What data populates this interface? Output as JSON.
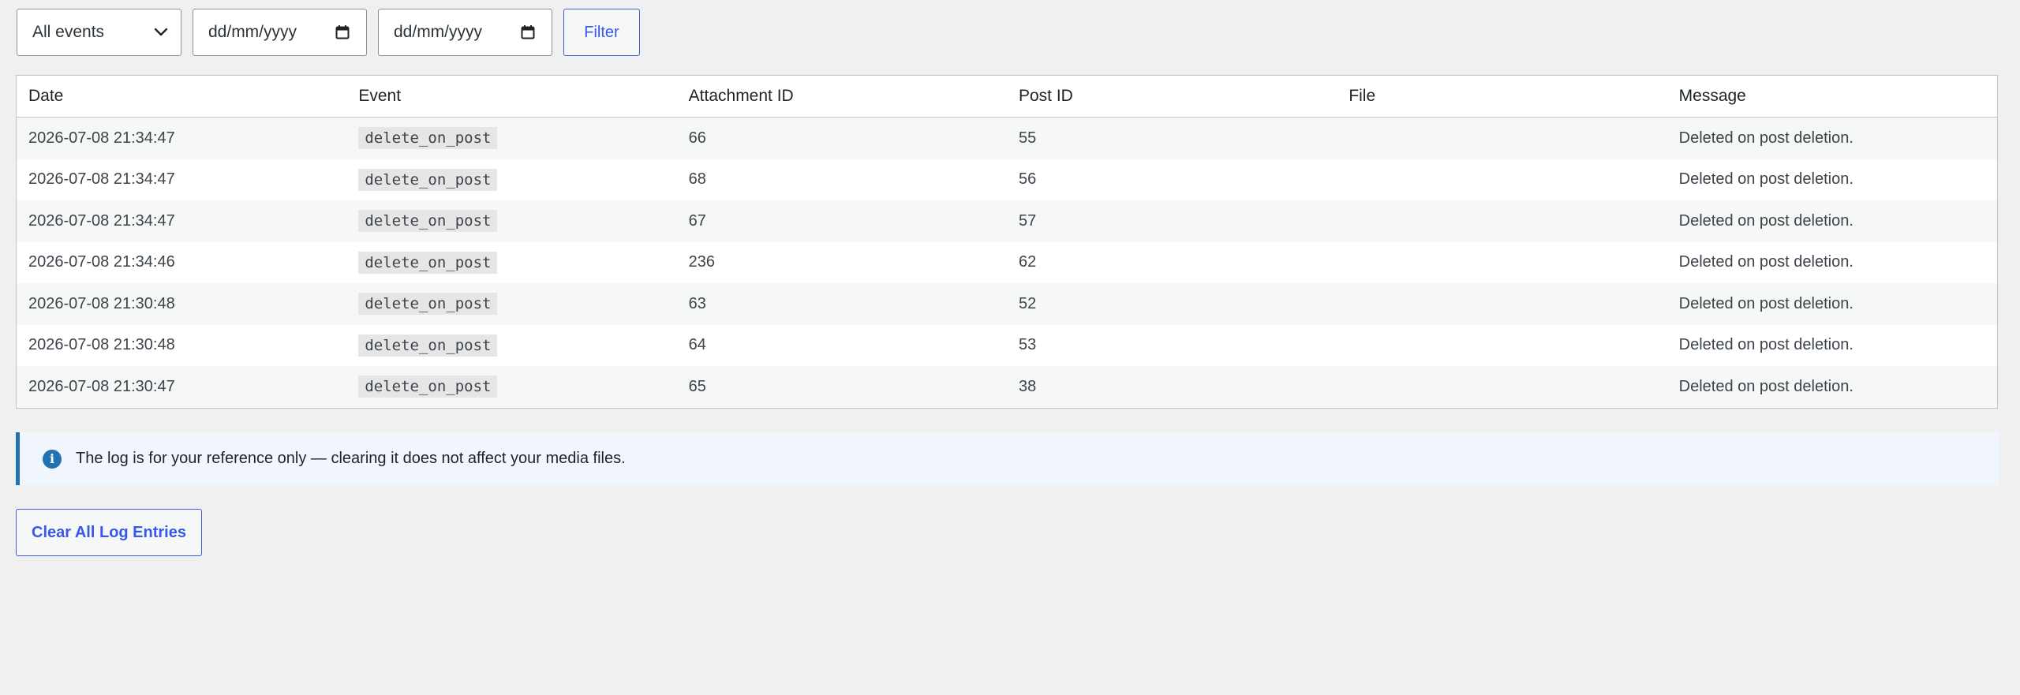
{
  "filters": {
    "event_select": {
      "value": "All events"
    },
    "date_from": {
      "placeholder": "dd/mm/yyyy"
    },
    "date_to": {
      "placeholder": "dd/mm/yyyy"
    },
    "filter_label": "Filter"
  },
  "table": {
    "headers": [
      "Date",
      "Event",
      "Attachment ID",
      "Post ID",
      "File",
      "Message"
    ],
    "rows": [
      {
        "date": "2026-07-08 21:34:47",
        "event": "delete_on_post",
        "attachment_id": "66",
        "post_id": "55",
        "file": "",
        "message": "Deleted on post deletion."
      },
      {
        "date": "2026-07-08 21:34:47",
        "event": "delete_on_post",
        "attachment_id": "68",
        "post_id": "56",
        "file": "",
        "message": "Deleted on post deletion."
      },
      {
        "date": "2026-07-08 21:34:47",
        "event": "delete_on_post",
        "attachment_id": "67",
        "post_id": "57",
        "file": "",
        "message": "Deleted on post deletion."
      },
      {
        "date": "2026-07-08 21:34:46",
        "event": "delete_on_post",
        "attachment_id": "236",
        "post_id": "62",
        "file": "",
        "message": "Deleted on post deletion."
      },
      {
        "date": "2026-07-08 21:30:48",
        "event": "delete_on_post",
        "attachment_id": "63",
        "post_id": "52",
        "file": "",
        "message": "Deleted on post deletion."
      },
      {
        "date": "2026-07-08 21:30:48",
        "event": "delete_on_post",
        "attachment_id": "64",
        "post_id": "53",
        "file": "",
        "message": "Deleted on post deletion."
      },
      {
        "date": "2026-07-08 21:30:47",
        "event": "delete_on_post",
        "attachment_id": "65",
        "post_id": "38",
        "file": "",
        "message": "Deleted on post deletion."
      }
    ]
  },
  "notice": {
    "icon": "info-icon",
    "text": "The log is for your reference only — clearing it does not affect your media files."
  },
  "actions": {
    "clear_label": "Clear All Log Entries"
  },
  "colors": {
    "accent": "#3858e9",
    "notice_border": "#2271b1",
    "notice_bg": "#f0f6fc",
    "row_stripe": "#f6f7f7"
  }
}
